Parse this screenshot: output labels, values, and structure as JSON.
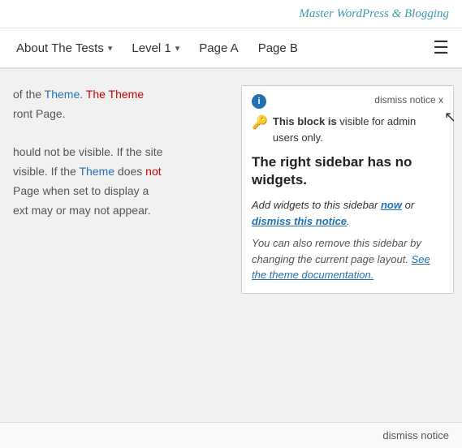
{
  "header": {
    "site_title": "Master WordPress & Blogging"
  },
  "nav": {
    "items": [
      {
        "label": "About The Tests",
        "has_dropdown": true,
        "active": false
      },
      {
        "label": "Level 1",
        "has_dropdown": true,
        "active": false
      },
      {
        "label": "Page A",
        "has_dropdown": false,
        "active": false
      },
      {
        "label": "Page B",
        "has_dropdown": false,
        "active": false
      }
    ],
    "hamburger_label": "☰"
  },
  "left_content": {
    "line1": "of the Theme. The Theme",
    "line2": "ront Page.",
    "line3": "hould not be visible. If the site",
    "line4": "visible. If the Theme does not",
    "line5": "Page when set to display a",
    "line6": "ext may or may not appear."
  },
  "notice": {
    "info_icon": "i",
    "dismiss_label": "dismiss notice x",
    "key_icon": "🔑",
    "visible_text_part1": "This block",
    "visible_text_bold": "is",
    "visible_text_part2": "visible for admin users only.",
    "title": "The right sidebar has no widgets.",
    "body1_prefix": "Add widgets to this sidebar ",
    "body1_link1": "now",
    "body1_middle": " or ",
    "body1_link2": "dismiss this notice",
    "body1_suffix": ".",
    "body2": "You can also remove this sidebar by changing the current page layout.",
    "body2_link": "See the theme documentation."
  },
  "bottom": {
    "dismiss_label": "dismiss notice"
  }
}
